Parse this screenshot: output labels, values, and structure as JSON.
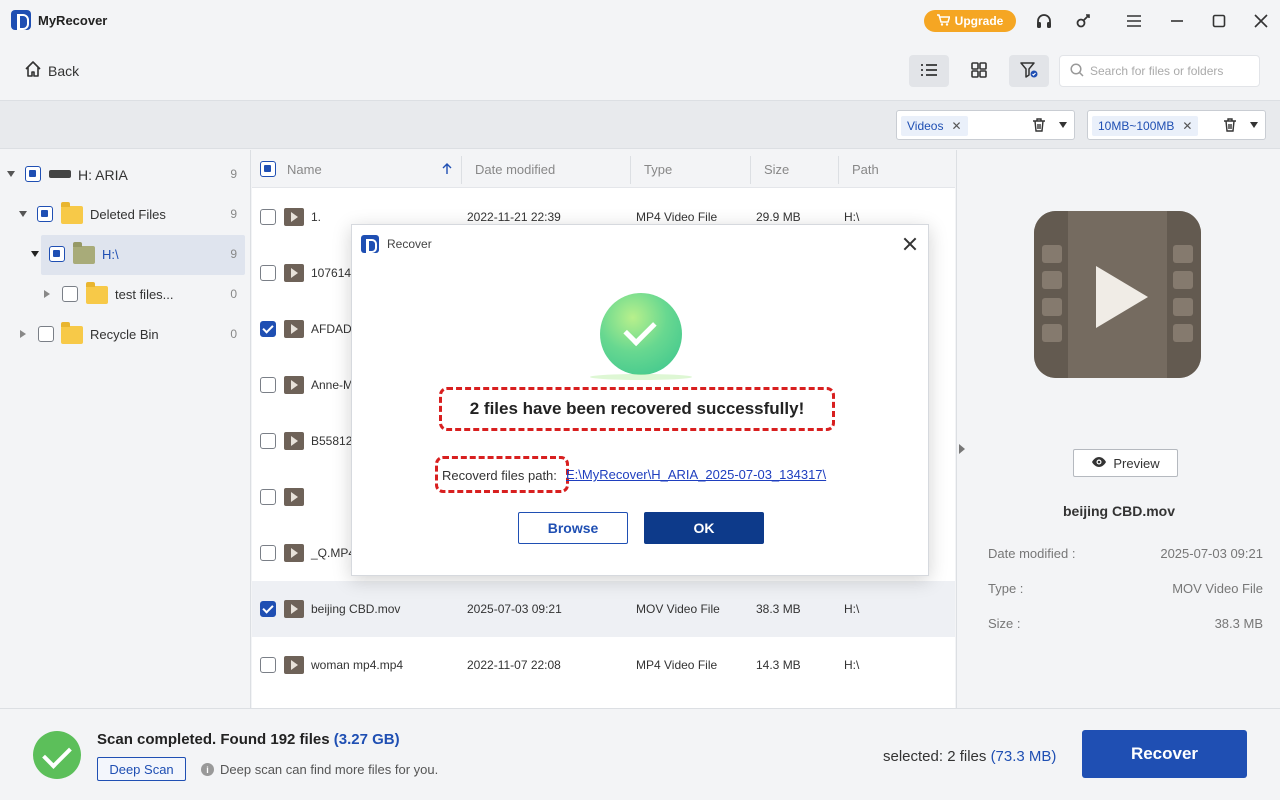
{
  "app": {
    "title": "MyRecover",
    "upgrade_label": "Upgrade"
  },
  "toolbar": {
    "back_label": "Back",
    "search_placeholder": "Search for files or folders"
  },
  "filters": [
    {
      "tag": "Videos"
    },
    {
      "tag": "10MB~100MB"
    }
  ],
  "tree": {
    "drive": {
      "label": "H: ARIA",
      "count": "9"
    },
    "deleted": {
      "label": "Deleted Files",
      "count": "9"
    },
    "h_root": {
      "label": "H:\\",
      "count": "9"
    },
    "test_files": {
      "label": "test files...",
      "count": "0"
    },
    "recycle": {
      "label": "Recycle Bin",
      "count": "0"
    }
  },
  "columns": {
    "name": "Name",
    "date": "Date modified",
    "type": "Type",
    "size": "Size",
    "path": "Path"
  },
  "files": [
    {
      "name": "1.",
      "date": "2022-11-21 22:39",
      "type": "MP4 Video File",
      "size": "29.9 MB",
      "path": "H:\\",
      "checked": false
    },
    {
      "name": "107614",
      "date": "",
      "type": "",
      "size": "",
      "path": "",
      "checked": false
    },
    {
      "name": "AFDAD",
      "date": "",
      "type": "",
      "size": "",
      "path": "",
      "checked": true
    },
    {
      "name": "Anne-M",
      "date": "",
      "type": "",
      "size": "",
      "path": "",
      "checked": false
    },
    {
      "name": "B55812",
      "date": "",
      "type": "",
      "size": "",
      "path": "",
      "checked": false
    },
    {
      "name": "",
      "date": "",
      "type": "",
      "size": "",
      "path": "",
      "checked": false
    },
    {
      "name": "_Q.MP4",
      "date": "",
      "type": "",
      "size": "",
      "path": "",
      "checked": false
    },
    {
      "name": "beijing CBD.mov",
      "date": "2025-07-03 09:21",
      "type": "MOV Video File",
      "size": "38.3 MB",
      "path": "H:\\",
      "checked": true
    },
    {
      "name": "woman mp4.mp4",
      "date": "2022-11-07 22:08",
      "type": "MP4 Video File",
      "size": "14.3 MB",
      "path": "H:\\",
      "checked": false
    }
  ],
  "preview": {
    "button_label": "Preview",
    "file_name": "beijing CBD.mov",
    "date_label": "Date modified :",
    "date_value": "2025-07-03 09:21",
    "type_label": "Type :",
    "type_value": "MOV Video File",
    "size_label": "Size :",
    "size_value": "38.3 MB"
  },
  "footer": {
    "scan_status": "Scan completed. Found 192 files",
    "scan_size": "(3.27 GB)",
    "deep_scan_label": "Deep Scan",
    "deep_hint": "Deep scan can find more files for you.",
    "selected_text": "selected: 2 files",
    "selected_size": "(73.3 MB)",
    "recover_label": "Recover"
  },
  "dialog": {
    "title": "Recover",
    "message": "2 files have been recovered successfully!",
    "path_label": "Recoverd files path:",
    "path_value": "E:\\MyRecover\\H_ARIA_2025-07-03_134317\\",
    "browse_label": "Browse",
    "ok_label": "OK"
  },
  "colors": {
    "accent": "#1f4fb3",
    "upgrade": "#f5a623",
    "success": "#5cbf5a",
    "highlight": "#d81f1f"
  }
}
